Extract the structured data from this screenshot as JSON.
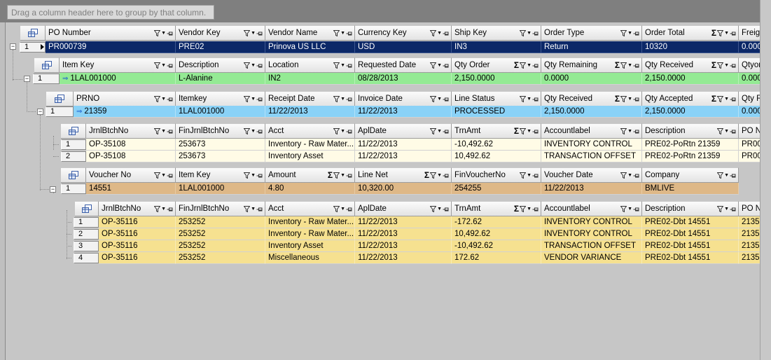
{
  "group_by_hint": "Drag a column header here to group by that column.",
  "icons": {
    "filter": "filter-funnel-icon",
    "dropdown": "dropdown-arrow-icon",
    "pin": "pin-icon",
    "sigma": "summary-sigma-icon",
    "chooser": "column-chooser-icon",
    "expand": "expand-collapse-icon",
    "row_arrow": "current-row-arrow-icon"
  },
  "colors": {
    "navy": "#0c2868",
    "green": "#94ea94",
    "blue": "#8ad2f7",
    "cream": "#fffbe6",
    "tan": "#deb887",
    "yellow": "#f6e190"
  },
  "po_band": {
    "headers": [
      "PO Number",
      "Vendor Key",
      "Vendor Name",
      "Currency Key",
      "Ship Key",
      "Order Type",
      "Order Total",
      "Freigh"
    ],
    "rows": [
      {
        "num": "1",
        "cells": [
          "PR000739",
          "PRE02",
          "Prinova US LLC",
          "USD",
          "IN3",
          "Return",
          "10320",
          "0.000"
        ]
      }
    ]
  },
  "item_band": {
    "headers": [
      "Item Key",
      "Description",
      "Location",
      "Requested Date",
      "Qty Order",
      "Qty Remaining",
      "Qty Received",
      "Qtyon"
    ],
    "rows": [
      {
        "num": "1",
        "cells": [
          "1LAL001000",
          "L-Alanine",
          "IN2",
          "08/28/2013",
          "2,150.0000",
          "0.0000",
          "2,150.0000",
          "0.000"
        ]
      }
    ]
  },
  "receipt_band": {
    "headers": [
      "PRNO",
      "Itemkey",
      "Receipt Date",
      "Invoice Date",
      "Line Status",
      "Qty Received",
      "Qty Accepted",
      "Qty R"
    ],
    "rows": [
      {
        "num": "1",
        "cells": [
          "21359",
          "1LAL001000",
          "11/22/2013",
          "11/22/2013",
          "PROCESSED",
          "2,150.0000",
          "2,150.0000",
          "0.000"
        ]
      }
    ]
  },
  "receipt_journal_band": {
    "headers": [
      "JrnlBtchNo",
      "FinJrnlBtchNo",
      "Acct",
      "AplDate",
      "TrnAmt",
      "Accountlabel",
      "Description",
      "PO N"
    ],
    "rows": [
      {
        "num": "1",
        "cells": [
          "OP-35108",
          "253673",
          "Inventory - Raw Mater...",
          "11/22/2013",
          "-10,492.62",
          "INVENTORY CONTROL",
          "PRE02-PoRtn 21359",
          "PR00"
        ]
      },
      {
        "num": "2",
        "cells": [
          "OP-35108",
          "253673",
          "Inventory Asset",
          "11/22/2013",
          "10,492.62",
          "TRANSACTION OFFSET",
          "PRE02-PoRtn 21359",
          "PR00"
        ]
      }
    ]
  },
  "voucher_band": {
    "headers": [
      "Voucher No",
      "Item Key",
      "Amount",
      "Line Net",
      "FinVoucherNo",
      "Voucher Date",
      "Company"
    ],
    "rows": [
      {
        "num": "1",
        "cells": [
          "14551",
          "1LAL001000",
          "4.80",
          "10,320.00",
          "254255",
          "11/22/2013",
          "BMLIVE"
        ]
      }
    ]
  },
  "voucher_journal_band": {
    "headers": [
      "JrnlBtchNo",
      "FinJrnlBtchNo",
      "Acct",
      "AplDate",
      "TrnAmt",
      "Accountlabel",
      "Description",
      "PO N"
    ],
    "rows": [
      {
        "num": "1",
        "cells": [
          "OP-35116",
          "253252",
          "Inventory - Raw Mater...",
          "11/22/2013",
          "-172.62",
          "INVENTORY CONTROL",
          "PRE02-Dbt 14551",
          "2135"
        ]
      },
      {
        "num": "2",
        "cells": [
          "OP-35116",
          "253252",
          "Inventory - Raw Mater...",
          "11/22/2013",
          "10,492.62",
          "INVENTORY CONTROL",
          "PRE02-Dbt 14551",
          "2135"
        ]
      },
      {
        "num": "3",
        "cells": [
          "OP-35116",
          "253252",
          "Inventory Asset",
          "11/22/2013",
          "-10,492.62",
          "TRANSACTION OFFSET",
          "PRE02-Dbt 14551",
          "2135"
        ]
      },
      {
        "num": "4",
        "cells": [
          "OP-35116",
          "253252",
          "Miscellaneous",
          "11/22/2013",
          "172.62",
          "VENDOR VARIANCE",
          "PRE02-Dbt 14551",
          "2135"
        ]
      }
    ]
  }
}
